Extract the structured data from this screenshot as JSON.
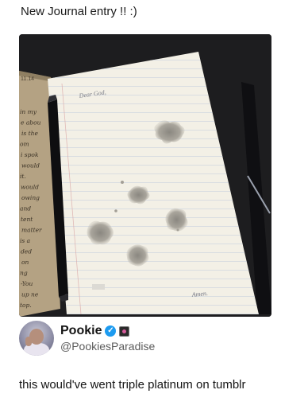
{
  "post": {
    "title": "New Journal entry !! :)"
  },
  "photo": {
    "journal_date": "11.14",
    "page_greeting": "Dear God,",
    "page_closing": "Amen.",
    "left_page_words": [
      "in my",
      "e abou",
      "is the",
      "om",
      "i spok",
      "would",
      "it.",
      "would",
      "owing",
      "and",
      "tent",
      "matter",
      "is a",
      "ded",
      "on",
      "ng",
      "-You",
      "up ne",
      "top."
    ]
  },
  "author": {
    "name": "Pookie",
    "handle": "@PookiesParadise",
    "verified_icon": "verified-badge-icon",
    "affiliate_icon": "affiliate-badge-icon"
  },
  "tweet": {
    "text": "this would've went triple platinum on tumblr"
  },
  "colors": {
    "verified": "#1d9bf0",
    "page": "#f3f0e6",
    "background": "#1c1c1c"
  }
}
